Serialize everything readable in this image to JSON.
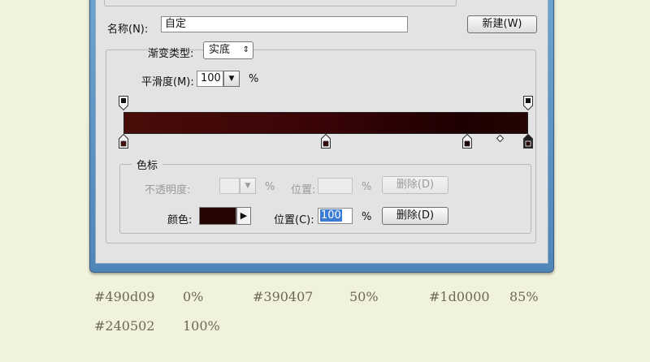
{
  "preset": {
    "name_label": "名称(N):",
    "name_value": "自定",
    "new_button": "新建(W)"
  },
  "gradient": {
    "type_label": "渐变类型:",
    "type_value": "实底",
    "smooth_label": "平滑度(M):",
    "smooth_value": "100",
    "smooth_unit": "%",
    "bar_colors": [
      "#490d09",
      "#390407",
      "#1d0000",
      "#240502"
    ],
    "color_stops": [
      {
        "color": "#490d09",
        "location": 0
      },
      {
        "color": "#390407",
        "location": 50
      },
      {
        "color": "#1d0000",
        "location": 85
      },
      {
        "color": "#240502",
        "location": 100
      }
    ],
    "opacity_stops": [
      {
        "location": 0
      },
      {
        "location": 100
      }
    ],
    "midpoint_location": 93
  },
  "stops_panel": {
    "title": "色标",
    "opacity_label": "不透明度:",
    "opacity_unit": "%",
    "opacity_location_label": "位置:",
    "opacity_location_unit": "%",
    "opacity_delete": "删除(D)",
    "color_label": "颜色:",
    "color_value": "#240502",
    "color_location_label": "位置(C):",
    "color_location_value": "100",
    "color_location_unit": "%",
    "color_delete": "删除(D)"
  },
  "annotations": [
    {
      "color": "#490d09",
      "percent": "0%"
    },
    {
      "color": "#390407",
      "percent": "50%"
    },
    {
      "color": "#1d0000",
      "percent": "85%"
    },
    {
      "color": "#240502",
      "percent": "100%"
    }
  ]
}
